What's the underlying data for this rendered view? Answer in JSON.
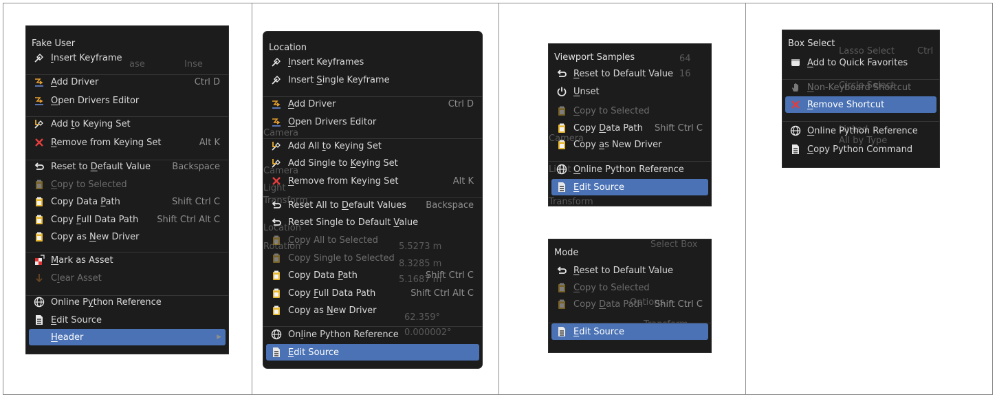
{
  "panel1": {
    "title": "Fake User",
    "ghost": [
      "ase",
      "Inse"
    ],
    "items": [
      {
        "icon": "keyframe-icon",
        "pre": "",
        "u": "I",
        "post": "nsert Keyframe",
        "shortcut": "",
        "disabled": false
      },
      {
        "icon": "driver-icon",
        "pre": "",
        "u": "A",
        "post": "dd Driver",
        "shortcut": "Ctrl D",
        "disabled": false
      },
      {
        "icon": "driver-icon",
        "pre": "",
        "u": "O",
        "post": "pen Drivers Editor",
        "shortcut": "",
        "disabled": false
      },
      {
        "icon": "keying-set-icon",
        "pre": "Add ",
        "u": "t",
        "post": "o Keying Set",
        "shortcut": "",
        "disabled": false
      },
      {
        "icon": "remove-x-icon",
        "pre": "",
        "u": "R",
        "post": "emove from Keying Set",
        "shortcut": "Alt K",
        "disabled": false
      },
      {
        "icon": "reset-icon",
        "pre": "Reset to ",
        "u": "D",
        "post": "efault Value",
        "shortcut": "Backspace",
        "disabled": false
      },
      {
        "icon": "clipboard-icon",
        "pre": "",
        "u": "C",
        "post": "opy to Selected",
        "shortcut": "",
        "disabled": true
      },
      {
        "icon": "clipboard-icon",
        "pre": "Copy Data ",
        "u": "P",
        "post": "ath",
        "shortcut": "Shift Ctrl C",
        "disabled": false
      },
      {
        "icon": "clipboard-icon",
        "pre": "Copy ",
        "u": "F",
        "post": "ull Data Path",
        "shortcut": "Shift Ctrl Alt C",
        "disabled": false
      },
      {
        "icon": "clipboard-icon",
        "pre": "Copy as ",
        "u": "N",
        "post": "ew Driver",
        "shortcut": "",
        "disabled": false
      },
      {
        "icon": "mark-asset-icon",
        "pre": "",
        "u": "M",
        "post": "ark as Asset",
        "shortcut": "",
        "disabled": false
      },
      {
        "icon": "clear-asset-icon",
        "pre": "C",
        "u": "l",
        "post": "ear Asset",
        "shortcut": "",
        "disabled": true
      },
      {
        "icon": "python-reference-icon",
        "pre": "Online P",
        "u": "y",
        "post": "thon Reference",
        "shortcut": "",
        "disabled": false
      },
      {
        "icon": "text-document-icon",
        "pre": "",
        "u": "E",
        "post": "dit Source",
        "shortcut": "",
        "disabled": false
      },
      {
        "icon": "",
        "pre": "",
        "u": "H",
        "post": "eader",
        "shortcut": "",
        "disabled": false,
        "highlighted": true,
        "submenu": true
      }
    ]
  },
  "panel2": {
    "title": "Location",
    "ghost": [
      "Camera",
      "Camera",
      "Light",
      "Transform",
      "Location",
      "Rotation",
      "5.5273 m",
      "8.3285 m",
      "5.1687 m",
      "62.359°",
      "0.000002°"
    ],
    "items": [
      {
        "icon": "keyframe-icon",
        "pre": "",
        "u": "I",
        "post": "nsert Keyframes",
        "shortcut": "",
        "disabled": false
      },
      {
        "icon": "keyframe-icon",
        "pre": "Insert ",
        "u": "S",
        "post": "ingle Keyframe",
        "shortcut": "",
        "disabled": false
      },
      {
        "icon": "driver-icon",
        "pre": "",
        "u": "A",
        "post": "dd Driver",
        "shortcut": "Ctrl D",
        "disabled": false
      },
      {
        "icon": "driver-icon",
        "pre": "",
        "u": "O",
        "post": "pen Drivers Editor",
        "shortcut": "",
        "disabled": false
      },
      {
        "icon": "keying-set-icon",
        "pre": "Add All ",
        "u": "t",
        "post": "o Keying Set",
        "shortcut": "",
        "disabled": false
      },
      {
        "icon": "keying-set-icon",
        "pre": "Add Single to ",
        "u": "K",
        "post": "eying Set",
        "shortcut": "",
        "disabled": false
      },
      {
        "icon": "remove-x-icon",
        "pre": "",
        "u": "R",
        "post": "emove from Keying Set",
        "shortcut": "Alt K",
        "disabled": false
      },
      {
        "icon": "reset-icon",
        "pre": "Reset All to ",
        "u": "D",
        "post": "efault Values",
        "shortcut": "Backspace",
        "disabled": false
      },
      {
        "icon": "reset-icon",
        "pre": "Reset Single to Default ",
        "u": "V",
        "post": "alue",
        "shortcut": "",
        "disabled": false
      },
      {
        "icon": "clipboard-icon",
        "pre": "",
        "u": "C",
        "post": "opy All to Selected",
        "shortcut": "",
        "disabled": true
      },
      {
        "icon": "clipboard-icon",
        "pre": "Copy Single to Selected",
        "u": "",
        "post": "",
        "shortcut": "",
        "disabled": true
      },
      {
        "icon": "clipboard-icon",
        "pre": "Copy Data ",
        "u": "P",
        "post": "ath",
        "shortcut": "Shift Ctrl C",
        "disabled": false
      },
      {
        "icon": "clipboard-icon",
        "pre": "Copy ",
        "u": "F",
        "post": "ull Data Path",
        "shortcut": "Shift Ctrl Alt C",
        "disabled": false
      },
      {
        "icon": "clipboard-icon",
        "pre": "Copy as ",
        "u": "N",
        "post": "ew Driver",
        "shortcut": "",
        "disabled": false
      },
      {
        "icon": "python-reference-icon",
        "pre": "On",
        "u": "l",
        "post": "ine Python Reference",
        "shortcut": "",
        "disabled": false
      },
      {
        "icon": "text-document-icon",
        "pre": "",
        "u": "E",
        "post": "dit Source",
        "shortcut": "",
        "disabled": false,
        "highlighted": true
      }
    ]
  },
  "panel3a": {
    "title": "Viewport Samples",
    "ghost": [
      "64",
      "16",
      "Camera",
      "Light",
      "Transform"
    ],
    "items": [
      {
        "icon": "reset-icon",
        "pre": "",
        "u": "R",
        "post": "eset to Default Value",
        "shortcut": "",
        "disabled": false
      },
      {
        "icon": "power-icon",
        "pre": "",
        "u": "U",
        "post": "nset",
        "shortcut": "",
        "disabled": false
      },
      {
        "icon": "clipboard-icon",
        "pre": "",
        "u": "C",
        "post": "opy to Selected",
        "shortcut": "",
        "disabled": true
      },
      {
        "icon": "clipboard-icon",
        "pre": "Copy ",
        "u": "D",
        "post": "ata Path",
        "shortcut": "Shift Ctrl C",
        "disabled": false
      },
      {
        "icon": "clipboard-icon",
        "pre": "Copy ",
        "u": "a",
        "post": "s New Driver",
        "shortcut": "",
        "disabled": false
      },
      {
        "icon": "python-reference-icon",
        "pre": "",
        "u": "O",
        "post": "nline Python Reference",
        "shortcut": "",
        "disabled": false
      },
      {
        "icon": "text-document-icon",
        "pre": "",
        "u": "E",
        "post": "dit Source",
        "shortcut": "",
        "disabled": false,
        "highlighted": true
      }
    ]
  },
  "panel3b": {
    "title": "Mode",
    "ghost": [
      "Select Box",
      "Options",
      "Transform"
    ],
    "items": [
      {
        "icon": "reset-icon",
        "pre": "",
        "u": "R",
        "post": "eset to Default Value",
        "shortcut": "",
        "disabled": false
      },
      {
        "icon": "clipboard-icon",
        "pre": "",
        "u": "C",
        "post": "opy to Selected",
        "shortcut": "",
        "disabled": true
      },
      {
        "icon": "clipboard-icon",
        "pre": "Copy ",
        "u": "D",
        "post": "ata Path",
        "shortcut": "Shift Ctrl C",
        "disabled": true
      },
      {
        "icon": "text-document-icon",
        "pre": "",
        "u": "E",
        "post": "dit Source",
        "shortcut": "",
        "disabled": false,
        "highlighted": true
      }
    ]
  },
  "panel4": {
    "title": "Box Select",
    "ghost": [
      "Lasso Select",
      "Ctrl",
      "Circle Select",
      "Linked",
      "All by Type"
    ],
    "items": [
      {
        "icon": "quick-favorites-icon",
        "pre": "",
        "u": "A",
        "post": "dd to Quick Favorites",
        "shortcut": "",
        "disabled": false
      },
      {
        "icon": "hand-icon",
        "pre": "",
        "u": "N",
        "post": "on-Keyboard Shortcut",
        "shortcut": "",
        "disabled": true
      },
      {
        "icon": "remove-x-icon",
        "pre": "",
        "u": "R",
        "post": "emove Shortcut",
        "shortcut": "",
        "disabled": false,
        "highlighted": true
      },
      {
        "icon": "python-reference-icon",
        "pre": "",
        "u": "O",
        "post": "nline Python Reference",
        "shortcut": "",
        "disabled": false
      },
      {
        "icon": "text-document-icon",
        "pre": "",
        "u": "C",
        "post": "opy Python Command",
        "shortcut": "",
        "disabled": false
      }
    ]
  },
  "colors": {
    "menu_bg": "#1c1c1c",
    "highlight": "#4a72b4",
    "text": "#d8d8d8",
    "shortcut": "#8e8e8e",
    "disabled": "#6e6e6e"
  }
}
